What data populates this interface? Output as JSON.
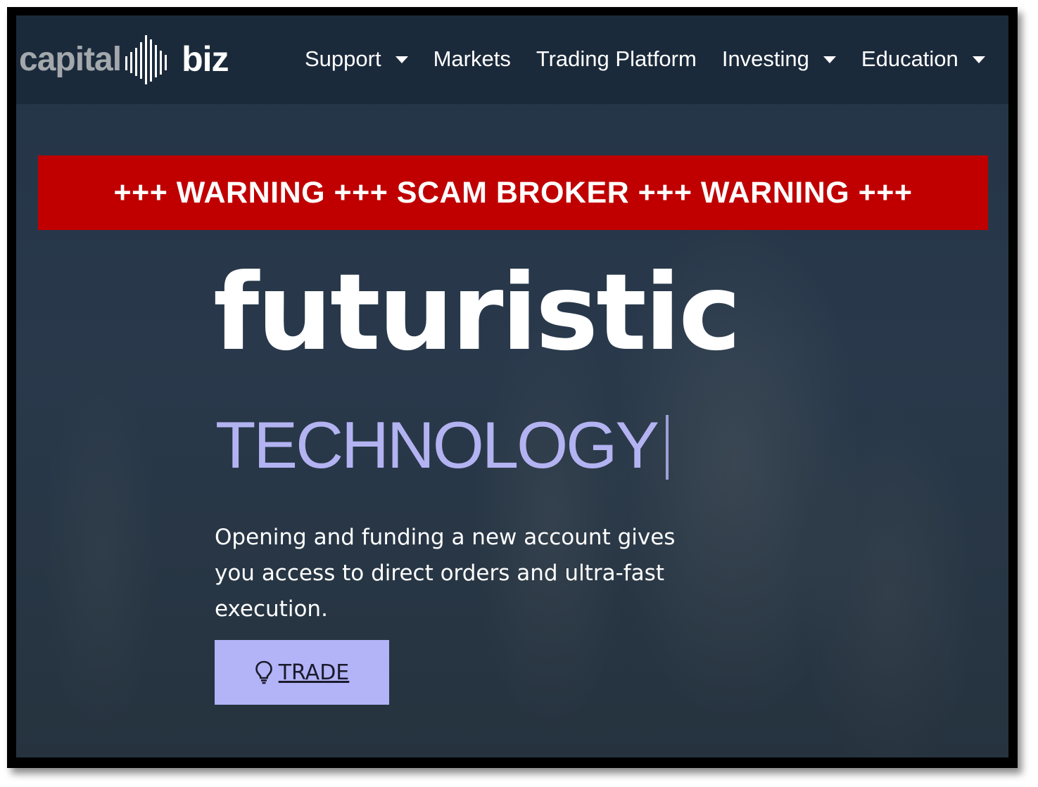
{
  "brand": {
    "logo_left": "capital",
    "logo_right": "biz",
    "logo_icon": "bars-logo-icon"
  },
  "nav": {
    "items": [
      {
        "label": "Support",
        "has_dropdown": true
      },
      {
        "label": "Markets",
        "has_dropdown": false
      },
      {
        "label": "Trading Platform",
        "has_dropdown": false
      },
      {
        "label": "Investing",
        "has_dropdown": true
      },
      {
        "label": "Education",
        "has_dropdown": true
      }
    ]
  },
  "warning_banner": {
    "text": "+++ WARNING +++ SCAM BROKER +++ WARNING +++",
    "color": "#c00000"
  },
  "hero": {
    "title": "futuristic",
    "subtitle": "TECHNOLOGY",
    "subtitle_color": "#b3b3f2",
    "description": "Opening and funding a new account gives you access to direct orders and ultra-fast execution.",
    "cta": {
      "label": "TRADE",
      "icon": "lightbulb-icon",
      "color": "#b3b3f8"
    }
  }
}
